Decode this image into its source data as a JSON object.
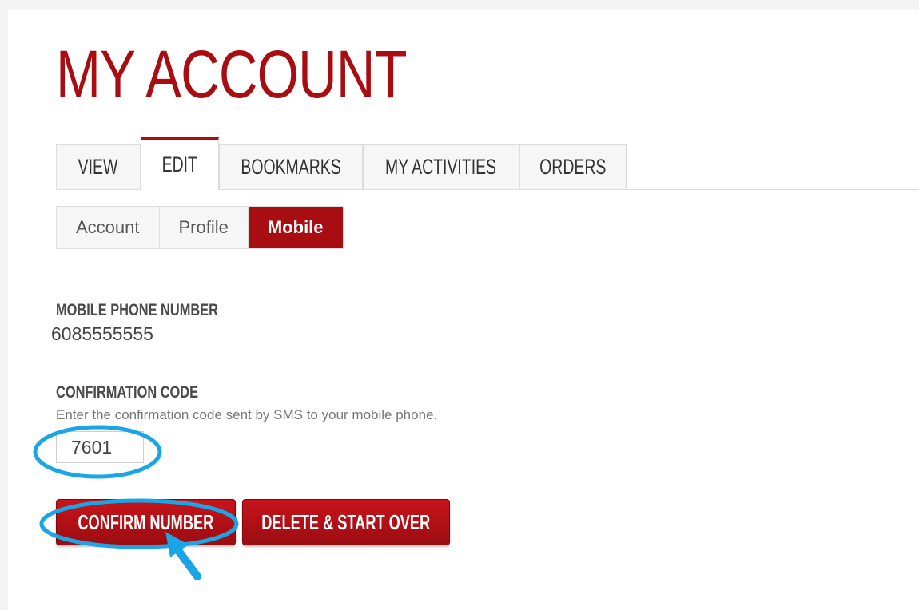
{
  "page": {
    "title": "MY ACCOUNT"
  },
  "tabs": [
    {
      "label": "VIEW"
    },
    {
      "label": "EDIT"
    },
    {
      "label": "BOOKMARKS"
    },
    {
      "label": "MY ACTIVITIES"
    },
    {
      "label": "ORDERS"
    }
  ],
  "active_tab": "EDIT",
  "subtabs": [
    {
      "label": "Account"
    },
    {
      "label": "Profile"
    },
    {
      "label": "Mobile"
    }
  ],
  "active_subtab": "Mobile",
  "mobile": {
    "phone_label": "MOBILE PHONE NUMBER",
    "phone_value": "6085555555",
    "code_label": "CONFIRMATION CODE",
    "code_help": "Enter the confirmation code sent by SMS to your mobile phone.",
    "code_value": "7601"
  },
  "buttons": {
    "confirm": "CONFIRM NUMBER",
    "delete": "DELETE & START OVER"
  },
  "colors": {
    "brand": "#a80d12",
    "annotation": "#1aa6e6"
  },
  "annotations": [
    "ellipse-highlight",
    "ellipse-highlight",
    "arrow-icon"
  ]
}
